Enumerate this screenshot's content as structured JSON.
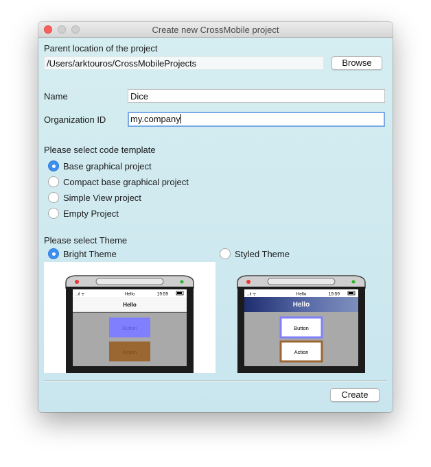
{
  "window": {
    "title": "Create new CrossMobile project"
  },
  "parent": {
    "label": "Parent location of the project",
    "path": "/Users/arktouros/CrossMobileProjects",
    "browse_label": "Browse"
  },
  "name": {
    "label": "Name",
    "value": "Dice"
  },
  "org": {
    "label": "Organization ID",
    "value": "my.company"
  },
  "template": {
    "label": "Please select code template",
    "options": [
      {
        "label": "Base graphical project",
        "selected": true
      },
      {
        "label": "Compact base graphical project",
        "selected": false
      },
      {
        "label": "Simple View project",
        "selected": false
      },
      {
        "label": "Empty Project",
        "selected": false
      }
    ]
  },
  "theme": {
    "label": "Please select Theme",
    "bright": {
      "label": "Bright Theme",
      "selected": true
    },
    "styled": {
      "label": "Styled Theme",
      "selected": false
    }
  },
  "previews": {
    "bright": {
      "status_left": "..ıl ᯤ",
      "status_center": "Hello",
      "status_right": "19:59",
      "nav_title": "Hello",
      "button1": "Button",
      "button2": "Action"
    },
    "styled": {
      "status_left": "..ıl ᯤ",
      "status_center": "Hello",
      "status_right": "19:59",
      "nav_title": "Hello",
      "button1": "Button",
      "button2": "Action"
    }
  },
  "footer": {
    "create_label": "Create"
  },
  "colors": {
    "accent": "#3d8ef0",
    "window_bg": "#d0ebf0",
    "close": "#fc605c"
  }
}
